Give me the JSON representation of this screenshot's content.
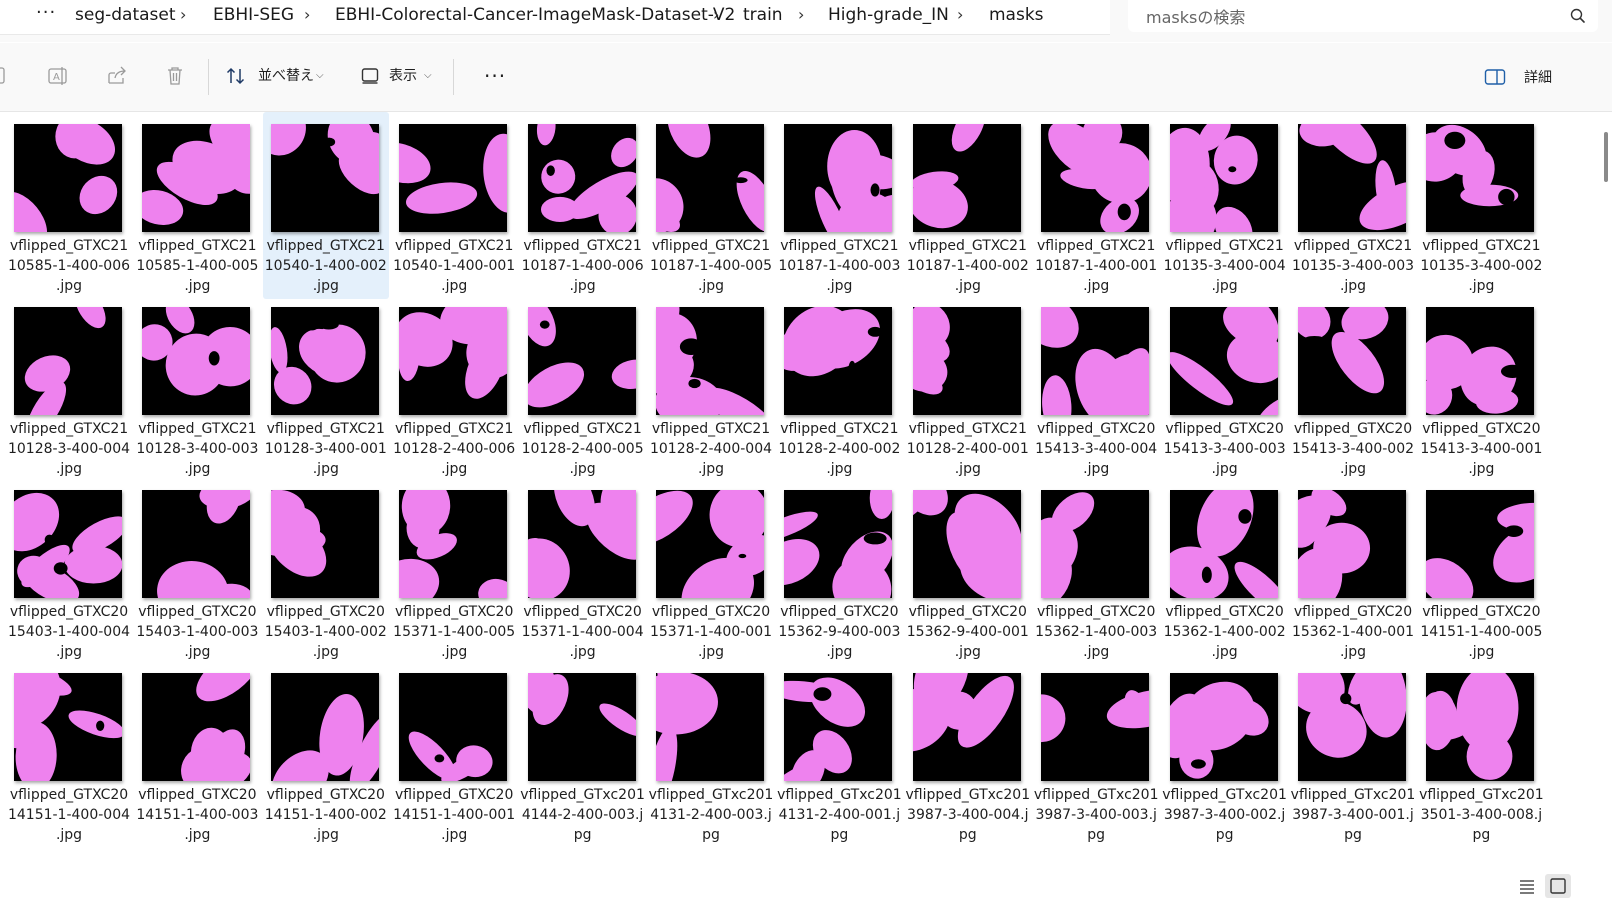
{
  "address": {
    "more_label": "···",
    "crumbs": [
      "seg-dataset",
      "EBHI-SEG",
      "EBHI-Colorectal-Cancer-ImageMask-Dataset-V2",
      "train",
      "High-grade_IN",
      "masks"
    ],
    "separator": "›",
    "search_placeholder": "masksの検索"
  },
  "toolbar": {
    "sort_label": "並べ替え",
    "view_label": "表示",
    "more_label": "···",
    "details_label": "詳細",
    "chevron": "⌵"
  },
  "colors": {
    "mask_fg": "#ee82ee",
    "mask_bg": "#000000",
    "selection": "#e4f0fb"
  },
  "files": [
    {
      "l1": "vflipped_GTXC21",
      "l2": "10585-1-400-006",
      "l3": ".jpg"
    },
    {
      "l1": "vflipped_GTXC21",
      "l2": "10585-1-400-005",
      "l3": ".jpg"
    },
    {
      "l1": "vflipped_GTXC21",
      "l2": "10540-1-400-002",
      "l3": ".jpg",
      "selected": true
    },
    {
      "l1": "vflipped_GTXC21",
      "l2": "10540-1-400-001",
      "l3": ".jpg"
    },
    {
      "l1": "vflipped_GTXC21",
      "l2": "10187-1-400-006",
      "l3": ".jpg"
    },
    {
      "l1": "vflipped_GTXC21",
      "l2": "10187-1-400-005",
      "l3": ".jpg"
    },
    {
      "l1": "vflipped_GTXC21",
      "l2": "10187-1-400-003",
      "l3": ".jpg"
    },
    {
      "l1": "vflipped_GTXC21",
      "l2": "10187-1-400-002",
      "l3": ".jpg"
    },
    {
      "l1": "vflipped_GTXC21",
      "l2": "10187-1-400-001",
      "l3": ".jpg"
    },
    {
      "l1": "vflipped_GTXC21",
      "l2": "10135-3-400-004",
      "l3": ".jpg"
    },
    {
      "l1": "vflipped_GTXC21",
      "l2": "10135-3-400-003",
      "l3": ".jpg"
    },
    {
      "l1": "vflipped_GTXC21",
      "l2": "10135-3-400-002",
      "l3": ".jpg"
    },
    {
      "l1": "vflipped_GTXC21",
      "l2": "10128-3-400-004",
      "l3": ".jpg"
    },
    {
      "l1": "vflipped_GTXC21",
      "l2": "10128-3-400-003",
      "l3": ".jpg"
    },
    {
      "l1": "vflipped_GTXC21",
      "l2": "10128-3-400-001",
      "l3": ".jpg"
    },
    {
      "l1": "vflipped_GTXC21",
      "l2": "10128-2-400-006",
      "l3": ".jpg"
    },
    {
      "l1": "vflipped_GTXC21",
      "l2": "10128-2-400-005",
      "l3": ".jpg"
    },
    {
      "l1": "vflipped_GTXC21",
      "l2": "10128-2-400-004",
      "l3": ".jpg"
    },
    {
      "l1": "vflipped_GTXC21",
      "l2": "10128-2-400-002",
      "l3": ".jpg"
    },
    {
      "l1": "vflipped_GTXC21",
      "l2": "10128-2-400-001",
      "l3": ".jpg"
    },
    {
      "l1": "vflipped_GTXC20",
      "l2": "15413-3-400-004",
      "l3": ".jpg"
    },
    {
      "l1": "vflipped_GTXC20",
      "l2": "15413-3-400-003",
      "l3": ".jpg"
    },
    {
      "l1": "vflipped_GTXC20",
      "l2": "15413-3-400-002",
      "l3": ".jpg"
    },
    {
      "l1": "vflipped_GTXC20",
      "l2": "15413-3-400-001",
      "l3": ".jpg"
    },
    {
      "l1": "vflipped_GTXC20",
      "l2": "15403-1-400-004",
      "l3": ".jpg"
    },
    {
      "l1": "vflipped_GTXC20",
      "l2": "15403-1-400-003",
      "l3": ".jpg"
    },
    {
      "l1": "vflipped_GTXC20",
      "l2": "15403-1-400-002",
      "l3": ".jpg"
    },
    {
      "l1": "vflipped_GTXC20",
      "l2": "15371-1-400-005",
      "l3": ".jpg"
    },
    {
      "l1": "vflipped_GTXC20",
      "l2": "15371-1-400-004",
      "l3": ".jpg"
    },
    {
      "l1": "vflipped_GTXC20",
      "l2": "15371-1-400-001",
      "l3": ".jpg"
    },
    {
      "l1": "vflipped_GTXC20",
      "l2": "15362-9-400-003",
      "l3": ".jpg"
    },
    {
      "l1": "vflipped_GTXC20",
      "l2": "15362-9-400-001",
      "l3": ".jpg"
    },
    {
      "l1": "vflipped_GTXC20",
      "l2": "15362-1-400-003",
      "l3": ".jpg"
    },
    {
      "l1": "vflipped_GTXC20",
      "l2": "15362-1-400-002",
      "l3": ".jpg"
    },
    {
      "l1": "vflipped_GTXC20",
      "l2": "15362-1-400-001",
      "l3": ".jpg"
    },
    {
      "l1": "vflipped_GTXC20",
      "l2": "14151-1-400-005",
      "l3": ".jpg"
    },
    {
      "l1": "vflipped_GTXC20",
      "l2": "14151-1-400-004",
      "l3": ".jpg"
    },
    {
      "l1": "vflipped_GTXC20",
      "l2": "14151-1-400-003",
      "l3": ".jpg"
    },
    {
      "l1": "vflipped_GTXC20",
      "l2": "14151-1-400-002",
      "l3": ".jpg"
    },
    {
      "l1": "vflipped_GTXC20",
      "l2": "14151-1-400-001",
      "l3": ".jpg"
    },
    {
      "l1": "vflipped_GTxc201",
      "l2": "4144-2-400-003.j",
      "l3": "pg"
    },
    {
      "l1": "vflipped_GTxc201",
      "l2": "4131-2-400-003.j",
      "l3": "pg"
    },
    {
      "l1": "vflipped_GTxc201",
      "l2": "4131-2-400-001.j",
      "l3": "pg"
    },
    {
      "l1": "vflipped_GTxc201",
      "l2": "3987-3-400-004.j",
      "l3": "pg"
    },
    {
      "l1": "vflipped_GTxc201",
      "l2": "3987-3-400-003.j",
      "l3": "pg"
    },
    {
      "l1": "vflipped_GTxc201",
      "l2": "3987-3-400-002.j",
      "l3": "pg"
    },
    {
      "l1": "vflipped_GTxc201",
      "l2": "3987-3-400-001.j",
      "l3": "pg"
    },
    {
      "l1": "vflipped_GTxc201",
      "l2": "3501-3-400-008.j",
      "l3": "pg"
    }
  ]
}
